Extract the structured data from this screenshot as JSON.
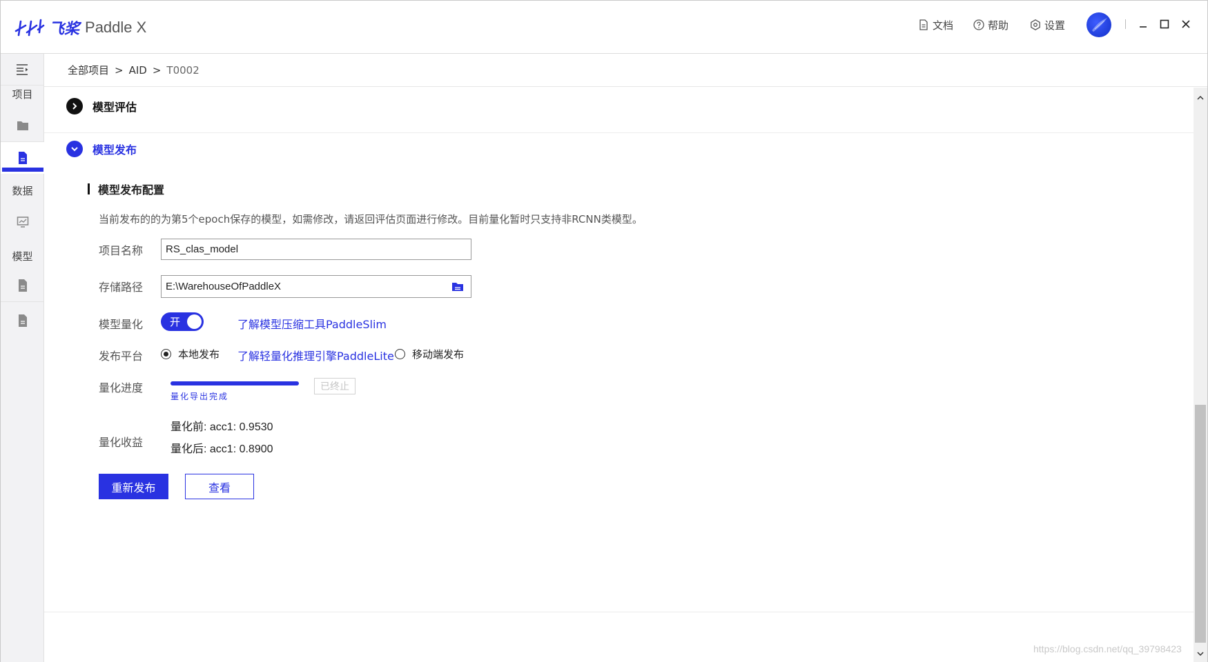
{
  "app": {
    "brand_cn": "飞桨",
    "brand_en": "Paddle X",
    "accent_color": "#2932e1"
  },
  "titlebar": {
    "links": [
      {
        "label": "文档",
        "icon": "document-icon"
      },
      {
        "label": "帮助",
        "icon": "help-icon"
      },
      {
        "label": "设置",
        "icon": "settings-icon"
      }
    ],
    "window_controls": [
      "minimize-icon",
      "maximize-icon",
      "close-icon"
    ]
  },
  "sidebar": {
    "groups": [
      {
        "label": "项目",
        "items": [
          "folder-icon",
          "file-icon"
        ]
      },
      {
        "label": "数据",
        "items": [
          "chart-icon"
        ]
      },
      {
        "label": "模型",
        "items": [
          "file-icon",
          "file-icon"
        ]
      }
    ],
    "active_item": "file-icon"
  },
  "breadcrumb": {
    "items": [
      "全部项目",
      "AID",
      "T0002"
    ],
    "separator": ">"
  },
  "sections": {
    "evaluate": {
      "title": "模型评估"
    },
    "publish": {
      "title": "模型发布"
    }
  },
  "publish_config": {
    "subtitle": "模型发布配置",
    "notice": "当前发布的的为第5个epoch保存的模型，如需修改，请返回评估页面进行修改。目前量化暂时只支持非RCNN类模型。",
    "project_name": {
      "label": "项目名称",
      "value": "RS_clas_model"
    },
    "storage_path": {
      "label": "存储路径",
      "value": "E:\\WarehouseOfPaddleX"
    },
    "quantize": {
      "label": "模型量化",
      "toggle_text": "开",
      "link": "了解模型压缩工具PaddleSlim"
    },
    "platform": {
      "label": "发布平台",
      "options": [
        {
          "label": "本地发布",
          "selected": true
        },
        {
          "label": "移动端发布",
          "selected": false
        }
      ],
      "link": "了解轻量化推理引擎PaddleLite"
    },
    "progress": {
      "label": "量化进度",
      "percent": 100,
      "status": "量化导出完成",
      "stop_label": "已终止"
    },
    "gain": {
      "label": "量化收益",
      "before": "量化前: acc1: 0.9530",
      "after": "量化后: acc1: 0.8900"
    },
    "actions": {
      "republish": "重新发布",
      "view": "查看"
    }
  },
  "watermark": "https://blog.csdn.net/qq_39798423"
}
